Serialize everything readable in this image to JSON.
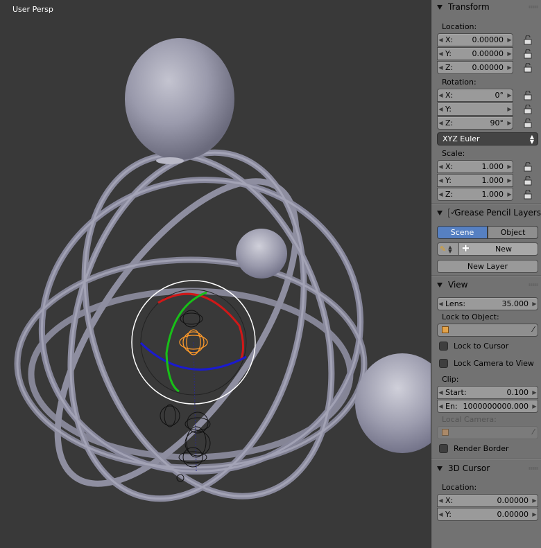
{
  "viewport": {
    "label": "User Persp",
    "colors": {
      "background": "#393939",
      "mesh": "#9a9ab0",
      "gizmo_x": "#d01818",
      "gizmo_y": "#18c018",
      "gizmo_z": "#1818d0",
      "selected": "#ff9a2a"
    }
  },
  "transform": {
    "title": "Transform",
    "location_label": "Location:",
    "location": [
      {
        "axis": "X:",
        "value": "0.00000"
      },
      {
        "axis": "Y:",
        "value": "0.00000"
      },
      {
        "axis": "Z:",
        "value": "0.00000"
      }
    ],
    "rotation_label": "Rotation:",
    "rotation": [
      {
        "axis": "X:",
        "value": "0°"
      },
      {
        "axis": "Y:",
        "value": ""
      },
      {
        "axis": "Z:",
        "value": "90°"
      }
    ],
    "rotation_mode": "XYZ Euler",
    "scale_label": "Scale:",
    "scale": [
      {
        "axis": "X:",
        "value": "1.000"
      },
      {
        "axis": "Y:",
        "value": "1.000"
      },
      {
        "axis": "Z:",
        "value": "1.000"
      }
    ]
  },
  "grease_pencil": {
    "title": "Grease Pencil Layers",
    "scene_label": "Scene",
    "object_label": "Object",
    "new_label": "New",
    "new_layer_label": "New Layer"
  },
  "view": {
    "title": "View",
    "lens_label": "Lens:",
    "lens_value": "35.000",
    "lock_to_object_label": "Lock to Object:",
    "lock_to_cursor_label": "Lock to Cursor",
    "lock_camera_label": "Lock Camera to View",
    "clip_label": "Clip:",
    "clip_start_label": "Start:",
    "clip_start_value": "0.100",
    "clip_end_label": "En:",
    "clip_end_value": "1000000000.000",
    "local_camera_label": "Local Camera:",
    "render_border_label": "Render Border"
  },
  "cursor3d": {
    "title": "3D Cursor",
    "location_label": "Location:",
    "location": [
      {
        "axis": "X:",
        "value": "0.00000"
      },
      {
        "axis": "Y:",
        "value": "0.00000"
      }
    ]
  }
}
